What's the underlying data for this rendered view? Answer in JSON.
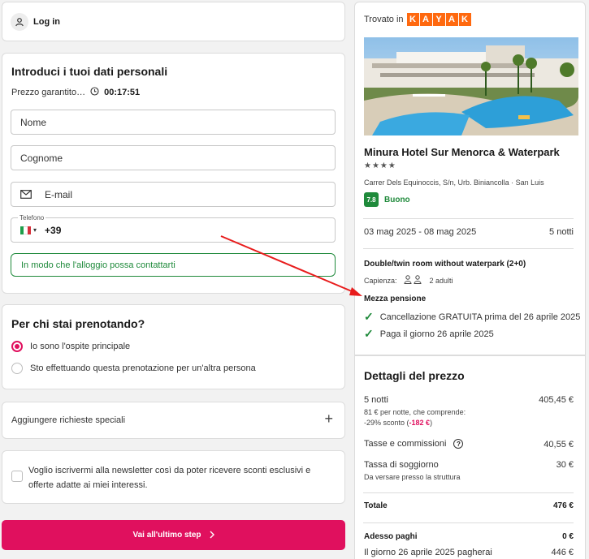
{
  "login": {
    "label": "Log in"
  },
  "personal": {
    "title": "Introduci i tuoi dati personali",
    "guarantee_text": "Prezzo garantito…",
    "timer": "00:17:51",
    "name_placeholder": "Nome",
    "surname_placeholder": "Cognome",
    "email_placeholder": "E-mail",
    "phone_label": "Telefono",
    "phone_prefix": "+39",
    "phone_hint": "In modo che l'alloggio possa contattarti"
  },
  "booking_for": {
    "title": "Per chi stai prenotando?",
    "option1": "Io sono l'ospite principale",
    "option2": "Sto effettuando questa prenotazione per un'altra persona"
  },
  "special_requests": {
    "label": "Aggiungere richieste speciali"
  },
  "newsletter": {
    "text": "Voglio iscrivermi alla newsletter così da poter ricevere sconti esclusivi e offerte adatte ai miei interessi."
  },
  "cta": {
    "label": "Vai all'ultimo step"
  },
  "hotel": {
    "found_in": "Trovato in",
    "kayak_letters": [
      "K",
      "A",
      "Y",
      "A",
      "K"
    ],
    "name": "Minura Hotel Sur Menorca & Waterpark",
    "stars": "★★★★",
    "address": "Carrer Dels Equinoccis, S/n, Urb. Biniancolla · San Luis",
    "score": "7.8",
    "score_label": "Buono",
    "dates": "03 mag 2025 - 08 mag 2025",
    "nights": "5 notti",
    "room": "Double/twin room without waterpark (2+0)",
    "capacity_label": "Capienza:",
    "capacity_value": "2 adulti",
    "board": "Mezza pensione",
    "perk1": "Cancellazione GRATUITA prima del 26 aprile 2025",
    "perk2": "Paga il giorno 26 aprile 2025"
  },
  "price": {
    "title": "Dettagli del prezzo",
    "nights_label": "5 notti",
    "nights_value": "405,45 €",
    "per_night": "81 € per notte, che comprende:",
    "discount_prefix": "-29% sconto (",
    "discount_value": "-182 €",
    "discount_suffix": ")",
    "taxes_label": "Tasse e commissioni",
    "taxes_value": "40,55 €",
    "stay_tax_label": "Tassa di soggiorno",
    "stay_tax_value": "30 €",
    "stay_tax_note": "Da versare presso la struttura",
    "total_label": "Totale",
    "total_value": "476 €",
    "pay_now_label": "Adesso paghi",
    "pay_now_value": "0 €",
    "pay_later_label": "Il giorno 26 aprile 2025 pagherai",
    "pay_later_value": "446 €"
  },
  "colors": {
    "accent": "#e0105e",
    "green": "#1f8a3b",
    "kayak": "#ff690f"
  }
}
